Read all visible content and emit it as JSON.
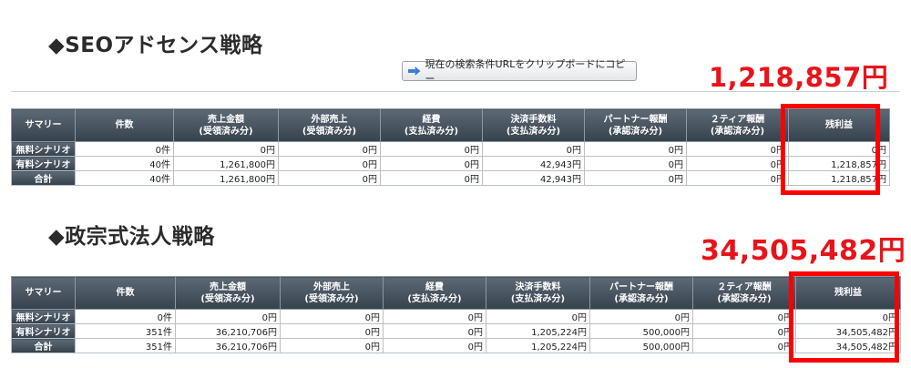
{
  "section1": {
    "title": "◆SEOアドセンス戦略",
    "total": "1,218,857円",
    "copy_button": "現在の検索条件URLをクリップボードにコピー",
    "headers": [
      "サマリー",
      "件数",
      "売上金額\n(受領済み分)",
      "外部売上\n(受領済み分)",
      "経費\n(支払済み分)",
      "決済手数料\n(支払済み分)",
      "パートナー報酬\n(承認済み分)",
      "２ティア報酬\n(承認済み分)",
      "残利益"
    ],
    "rows": [
      [
        "無料シナリオ",
        "0件",
        "0円",
        "0円",
        "0円",
        "0円",
        "0円",
        "0円",
        "0円"
      ],
      [
        "有料シナリオ",
        "40件",
        "1,261,800円",
        "0円",
        "0円",
        "42,943円",
        "0円",
        "0円",
        "1,218,857円"
      ],
      [
        "合計",
        "40件",
        "1,261,800円",
        "0円",
        "0円",
        "42,943円",
        "0円",
        "0円",
        "1,218,857円"
      ]
    ]
  },
  "section2": {
    "title": "◆政宗式法人戦略",
    "total": "34,505,482円",
    "headers": [
      "サマリー",
      "件数",
      "売上金額\n(受領済み分)",
      "外部売上\n(受領済み分)",
      "経費\n(支払済み分)",
      "決済手数料\n(支払済み分)",
      "パートナー報酬\n(承認済み分)",
      "２ティア報酬\n(承認済み分)",
      "残利益"
    ],
    "rows": [
      [
        "無料シナリオ",
        "0件",
        "0円",
        "0円",
        "0円",
        "0円",
        "0円",
        "0円",
        "0円"
      ],
      [
        "有料シナリオ",
        "351件",
        "36,210,706円",
        "0円",
        "0円",
        "1,205,224円",
        "500,000円",
        "0円",
        "34,505,482円"
      ],
      [
        "合計",
        "351件",
        "36,210,706円",
        "0円",
        "0円",
        "1,205,224円",
        "500,000円",
        "0円",
        "34,505,482円"
      ]
    ]
  },
  "colors": {
    "accent_red": "#ff0000",
    "total_red": "#e8141b",
    "header_dark": "#36414c"
  },
  "icons": {
    "copy_button_icon": "arrow-right-icon"
  }
}
